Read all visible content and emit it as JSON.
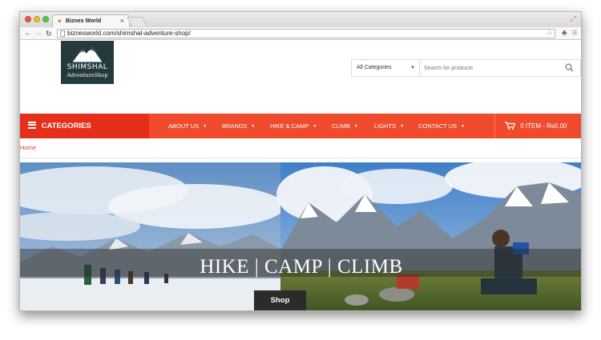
{
  "browser": {
    "tab_title": "Biznes World",
    "tab_close": "×",
    "url": "biznesworld.com/shimshal-adventure-shop/"
  },
  "logo": {
    "name": "SHIMSHAL",
    "subtitle": "AdventureShop"
  },
  "search": {
    "category_selected": "All Categories",
    "placeholder": "Search for products"
  },
  "nav": {
    "categories_label": "CATEGORIES",
    "items": [
      "ABOUT US",
      "BRANDS",
      "HIKE & CAMP",
      "CLIMB",
      "LIGHTS",
      "CONTACT US"
    ],
    "cart_label": "0 ITEM - Rs0.00"
  },
  "breadcrumb": "Home",
  "hero": {
    "title": "HIKE | CAMP | CLIMB",
    "button_label": "Shop"
  },
  "colors": {
    "nav_bar": "#f04b2d",
    "categories_bg": "#e62f1a",
    "logo_bg": "#243a3f",
    "breadcrumb": "#e33b22"
  },
  "icons": [
    "back-icon",
    "forward-icon",
    "reload-icon",
    "bookmark-star-icon",
    "extension-icon",
    "browser-menu-icon",
    "search-icon",
    "list-icon",
    "cart-icon",
    "mountain-logo-icon"
  ]
}
